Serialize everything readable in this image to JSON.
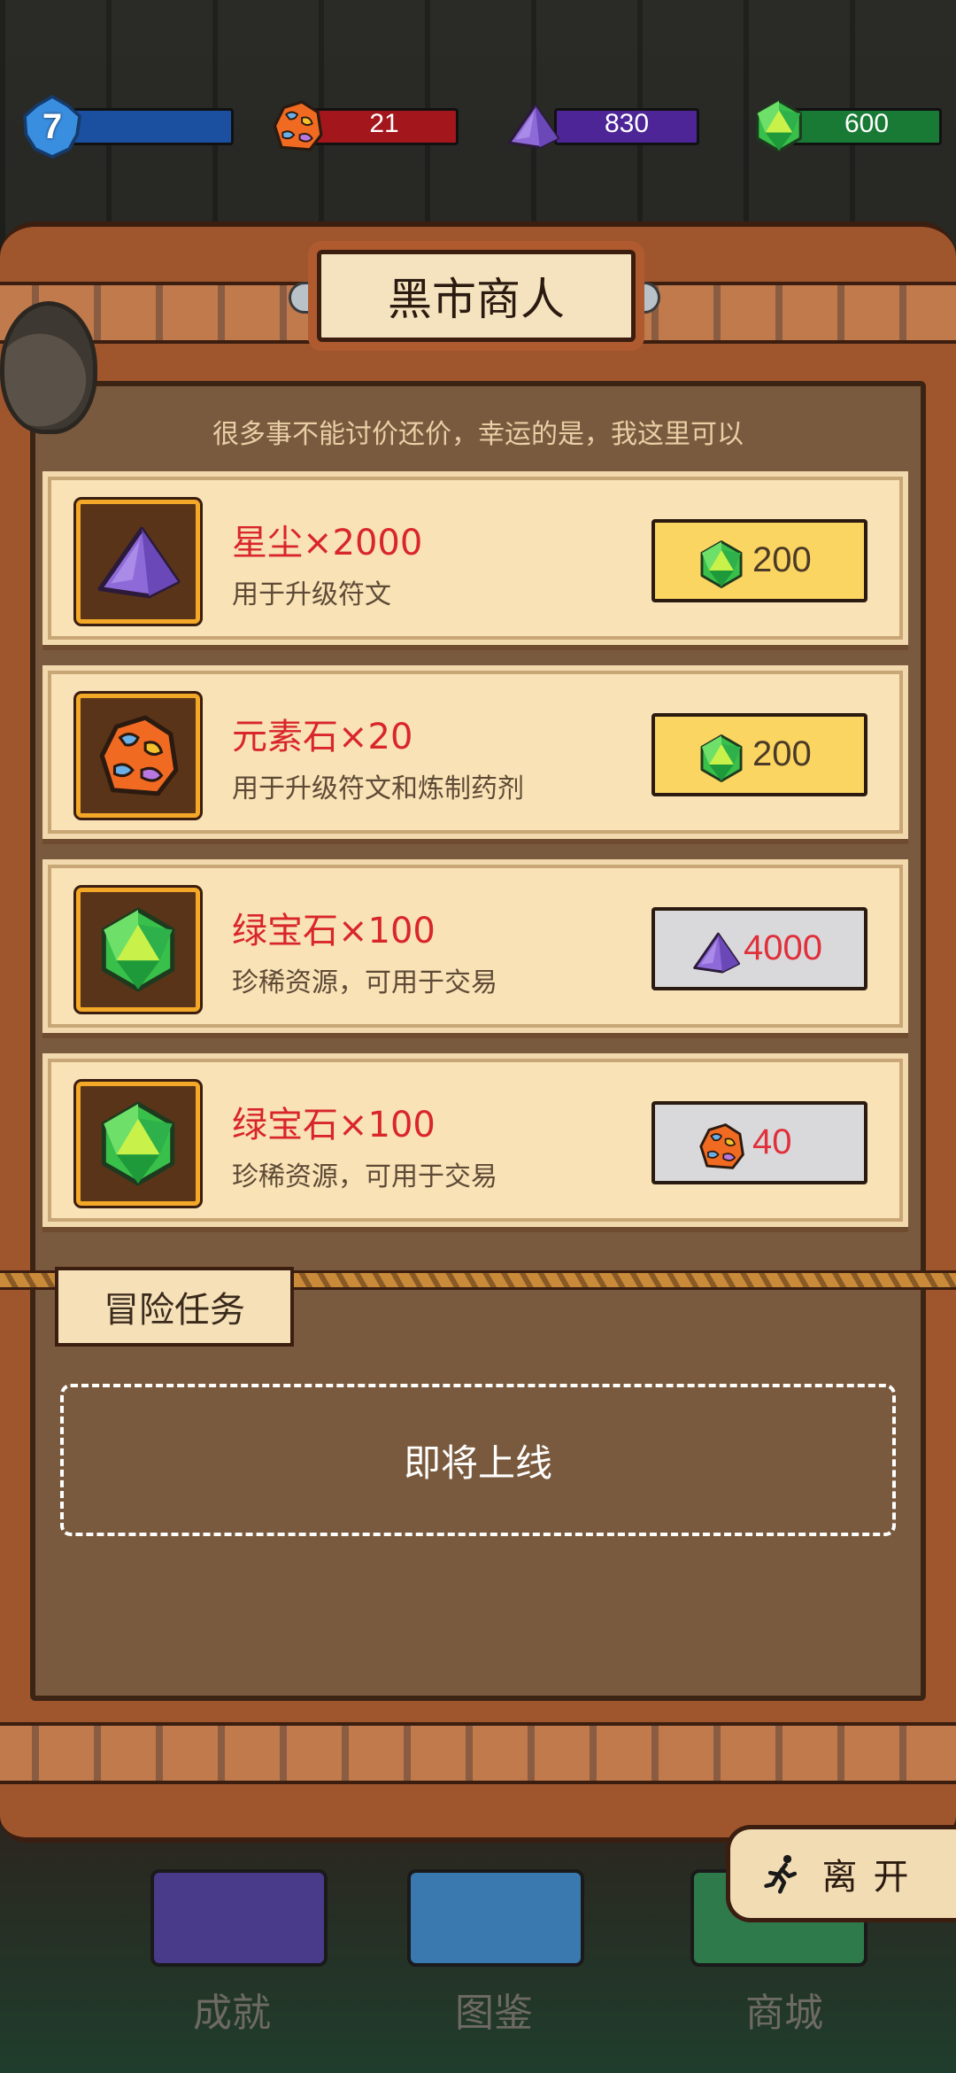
{
  "resources": {
    "level": "7",
    "element_stone": "21",
    "stardust": "830",
    "emerald": "600"
  },
  "panel": {
    "title": "黑市商人",
    "subtitle": "很多事不能讨价还价，幸运的是，我这里可以"
  },
  "items": [
    {
      "name": "星尘×2000",
      "desc": "用于升级符文",
      "icon": "stardust-icon",
      "price_icon": "emerald-icon",
      "price": "200",
      "price_style": "gold"
    },
    {
      "name": "元素石×20",
      "desc": "用于升级符文和炼制药剂",
      "icon": "element-stone-icon",
      "price_icon": "emerald-icon",
      "price": "200",
      "price_style": "gold"
    },
    {
      "name": "绿宝石×100",
      "desc": "珍稀资源，可用于交易",
      "icon": "emerald-icon",
      "price_icon": "stardust-icon",
      "price": "4000",
      "price_style": "grey"
    },
    {
      "name": "绿宝石×100",
      "desc": "珍稀资源，可用于交易",
      "icon": "emerald-icon",
      "price_icon": "element-stone-icon",
      "price": "40",
      "price_style": "grey"
    }
  ],
  "adventure": {
    "tab_label": "冒险任务",
    "placeholder": "即将上线"
  },
  "leave_button": "离开",
  "nav": {
    "achievements": "成就",
    "codex": "图鉴",
    "shop": "商城"
  },
  "colors": {
    "price_gold": "#fbd561",
    "price_grey": "#d9d9dc",
    "item_name": "#d9262a",
    "level_bar": "#1b4fa0",
    "element_bar": "#a3161c",
    "stardust_bar": "#4d2596",
    "emerald_bar": "#187a34"
  }
}
